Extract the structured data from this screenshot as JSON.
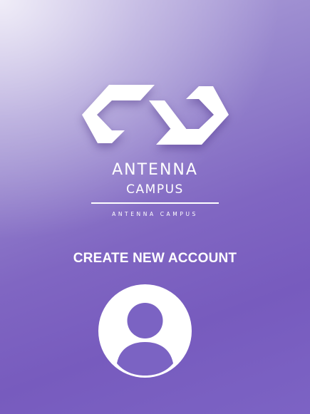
{
  "branding": {
    "logo_icon": "antenna-campus-logo-mark",
    "name": "ANTENNA",
    "subname": "CAMPUS",
    "tagline": "ANTENNA CAMPUS"
  },
  "page": {
    "heading": "CREATE NEW ACCOUNT"
  },
  "avatar": {
    "icon": "user-avatar-icon",
    "background_color": "#ffffff",
    "icon_color": "#7b63c3"
  },
  "theme": {
    "gradient_start": "#d7d0ee",
    "gradient_end": "#7458be",
    "text_color": "#ffffff"
  }
}
